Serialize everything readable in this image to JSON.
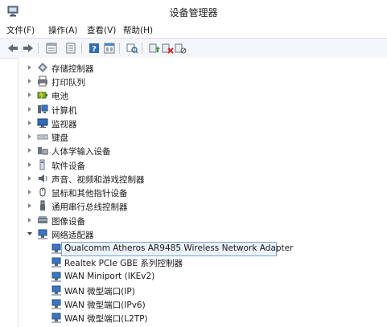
{
  "window": {
    "title": "设备管理器"
  },
  "menu": [
    "文件(F)",
    "操作(A)",
    "查看(V)",
    "帮助(H)"
  ],
  "toolbar_icons": [
    "back-arrow-icon",
    "forward-arrow-icon",
    "properties-icon",
    "view-icon",
    "help-icon",
    "view2-icon",
    "scan-hardware-icon",
    "update-driver-icon",
    "uninstall-icon",
    "disable-icon"
  ],
  "tree": {
    "categories": [
      {
        "label": "存储控制器",
        "icon": "storage-icon",
        "expanded": false
      },
      {
        "label": "打印队列",
        "icon": "printer-icon",
        "expanded": false
      },
      {
        "label": "电池",
        "icon": "battery-icon",
        "expanded": false
      },
      {
        "label": "计算机",
        "icon": "computer-icon",
        "expanded": false
      },
      {
        "label": "监视器",
        "icon": "monitor-icon",
        "expanded": false
      },
      {
        "label": "键盘",
        "icon": "keyboard-icon",
        "expanded": false
      },
      {
        "label": "人体学输入设备",
        "icon": "hid-icon",
        "expanded": false
      },
      {
        "label": "软件设备",
        "icon": "software-device-icon",
        "expanded": false
      },
      {
        "label": "声音、视频和游戏控制器",
        "icon": "speaker-icon",
        "expanded": false
      },
      {
        "label": "鼠标和其他指针设备",
        "icon": "mouse-icon",
        "expanded": false
      },
      {
        "label": "通用串行总线控制器",
        "icon": "usb-icon",
        "expanded": false
      },
      {
        "label": "图像设备",
        "icon": "camera-icon",
        "expanded": false
      },
      {
        "label": "网络适配器",
        "icon": "network-icon",
        "expanded": true
      }
    ],
    "network_children": [
      {
        "label": "Qualcomm Atheros AR9485 Wireless Network Adapter",
        "selected": true
      },
      {
        "label": "Realtek PCIe GBE 系列控制器",
        "selected": false
      },
      {
        "label": "WAN Miniport (IKEv2)",
        "selected": false
      },
      {
        "label": "WAN 微型端口(IP)",
        "selected": false
      },
      {
        "label": "WAN 微型端口(IPv6)",
        "selected": false
      },
      {
        "label": "WAN 微型端口(L2TP)",
        "selected": false
      }
    ]
  }
}
